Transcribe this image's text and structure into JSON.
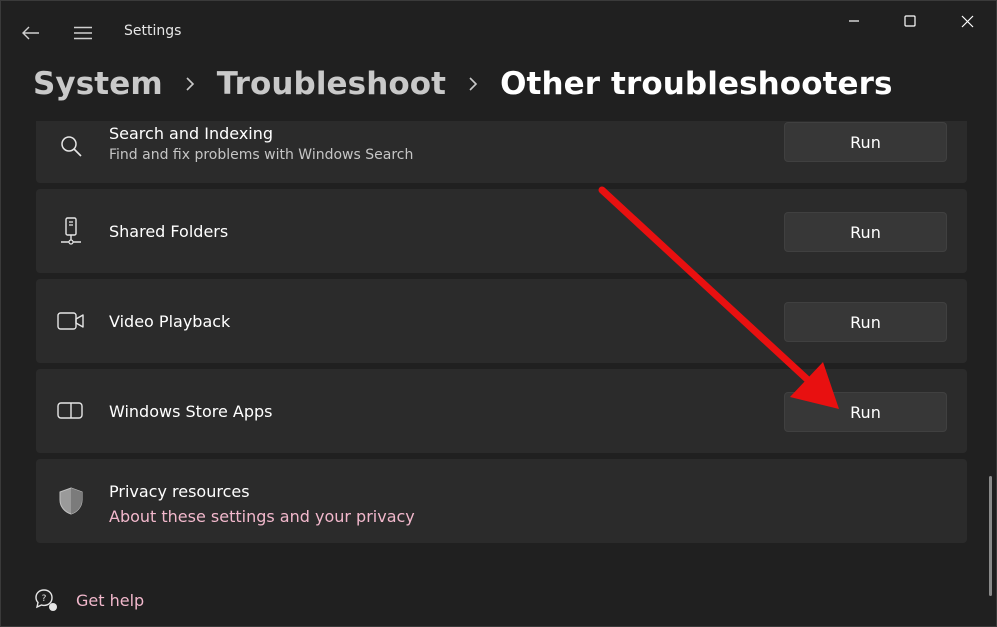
{
  "window": {
    "title": "Settings"
  },
  "breadcrumb": {
    "items": [
      "System",
      "Troubleshoot",
      "Other troubleshooters"
    ]
  },
  "troubleshooters": [
    {
      "name": "Search and Indexing",
      "description": "Find and fix problems with Windows Search",
      "icon": "search-icon",
      "button": "Run"
    },
    {
      "name": "Shared Folders",
      "icon": "shared-folders-icon",
      "button": "Run"
    },
    {
      "name": "Video Playback",
      "icon": "video-camera-icon",
      "button": "Run"
    },
    {
      "name": "Windows Store Apps",
      "icon": "store-apps-icon",
      "button": "Run"
    }
  ],
  "privacy": {
    "title": "Privacy resources",
    "link": "About these settings and your privacy",
    "icon": "shield-icon"
  },
  "help": {
    "label": "Get help",
    "icon": "help-chat-icon"
  },
  "colors": {
    "background": "#202020",
    "card": "#2b2b2b",
    "button": "#373737",
    "link_accent": "#f2b8cc",
    "annotation_arrow": "#e81010"
  }
}
